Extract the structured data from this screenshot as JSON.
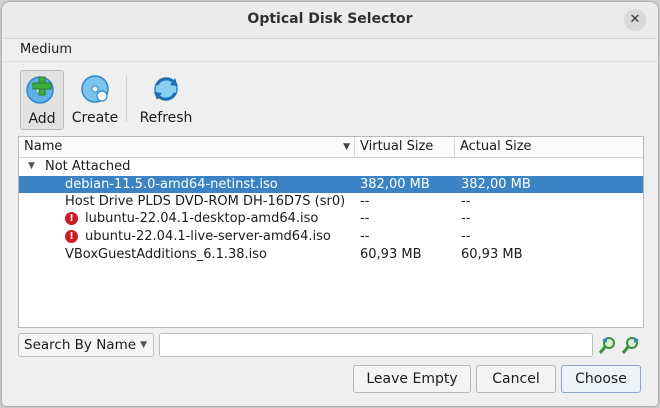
{
  "window": {
    "title": "Optical Disk Selector",
    "close_glyph": "✕"
  },
  "menubar": {
    "items": [
      "Medium"
    ]
  },
  "toolbar": {
    "add_label": "Add",
    "create_label": "Create",
    "refresh_label": "Refresh"
  },
  "table": {
    "columns": [
      "Name",
      "Virtual Size",
      "Actual Size"
    ],
    "group": {
      "label": "Not Attached",
      "expanded": true
    },
    "rows": [
      {
        "name": "debian-11.5.0-amd64-netinst.iso",
        "virtual_size": "382,00 MB",
        "actual_size": "382,00 MB",
        "selected": true,
        "error": false
      },
      {
        "name": "Host Drive PLDS DVD-ROM DH-16D7S (sr0)",
        "virtual_size": "--",
        "actual_size": "--",
        "selected": false,
        "error": false
      },
      {
        "name": "lubuntu-22.04.1-desktop-amd64.iso",
        "virtual_size": "--",
        "actual_size": "--",
        "selected": false,
        "error": true
      },
      {
        "name": "ubuntu-22.04.1-live-server-amd64.iso",
        "virtual_size": "--",
        "actual_size": "--",
        "selected": false,
        "error": true
      },
      {
        "name": "VBoxGuestAdditions_6.1.38.iso",
        "virtual_size": "60,93 MB",
        "actual_size": "60,93 MB",
        "selected": false,
        "error": false
      }
    ]
  },
  "search": {
    "mode_label": "Search By Name",
    "value": ""
  },
  "buttons": {
    "leave_empty": "Leave Empty",
    "cancel": "Cancel",
    "choose": "Choose"
  },
  "colors": {
    "selection": "#3b83c4",
    "error": "#cc1b24",
    "icon_blue": "#2e86c9",
    "icon_green": "#3fae3f"
  }
}
